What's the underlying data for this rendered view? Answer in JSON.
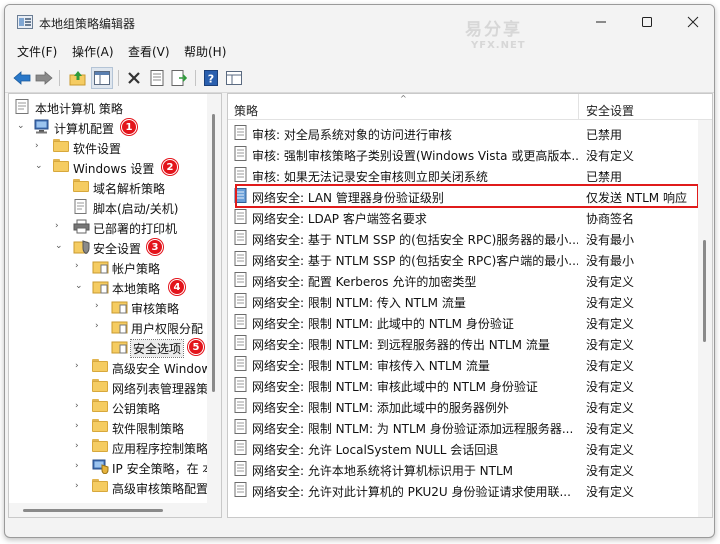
{
  "window": {
    "title": "本地组策略编辑器",
    "watermark_main": "易分享",
    "watermark_sub": "YFX.NET"
  },
  "menu": [
    {
      "label": "文件(F)"
    },
    {
      "label": "操作(A)"
    },
    {
      "label": "查看(V)"
    },
    {
      "label": "帮助(H)"
    }
  ],
  "toolbar": {
    "icons": [
      "back-arrow-icon",
      "forward-arrow-icon",
      "up-folder-icon",
      "show-hide-tree-icon",
      "delete-icon",
      "properties-icon",
      "export-list-icon",
      "help-icon",
      "extended-view-icon"
    ]
  },
  "tree": [
    {
      "label": "本地计算机 策略"
    },
    {
      "label": "计算机配置",
      "badge": "1"
    },
    {
      "label": "软件设置"
    },
    {
      "label": "Windows 设置",
      "badge": "2"
    },
    {
      "label": "域名解析策略"
    },
    {
      "label": "脚本(启动/关机)"
    },
    {
      "label": "已部署的打印机"
    },
    {
      "label": "安全设置",
      "badge": "3"
    },
    {
      "label": "帐户策略"
    },
    {
      "label": "本地策略",
      "badge": "4"
    },
    {
      "label": "审核策略"
    },
    {
      "label": "用户权限分配"
    },
    {
      "label": "安全选项",
      "badge": "5"
    },
    {
      "label": "高级安全 Windows"
    },
    {
      "label": "网络列表管理器策略"
    },
    {
      "label": "公钥策略"
    },
    {
      "label": "软件限制策略"
    },
    {
      "label": "应用程序控制策略"
    },
    {
      "label": "IP 安全策略，在 本"
    },
    {
      "label": "高级审核策略配置"
    }
  ],
  "list": {
    "col_policy": "策略",
    "col_setting": "安全设置",
    "rows": [
      {
        "name": "审核: 对全局系统对象的访问进行审核",
        "setting": "已禁用"
      },
      {
        "name": "审核: 强制审核策略子类别设置(Windows Vista 或更高版本...",
        "setting": "没有定义"
      },
      {
        "name": "审核: 如果无法记录安全审核则立即关闭系统",
        "setting": "已禁用"
      },
      {
        "name": "网络安全: LAN 管理器身份验证级别",
        "setting": "仅发送 NTLM 响应"
      },
      {
        "name": "网络安全: LDAP 客户端签名要求",
        "setting": "协商签名"
      },
      {
        "name": "网络安全: 基于 NTLM SSP 的(包括安全 RPC)服务器的最小...",
        "setting": "没有最小"
      },
      {
        "name": "网络安全: 基于 NTLM SSP 的(包括安全 RPC)客户端的最小...",
        "setting": "没有最小"
      },
      {
        "name": "网络安全: 配置 Kerberos 允许的加密类型",
        "setting": "没有定义"
      },
      {
        "name": "网络安全: 限制 NTLM: 传入 NTLM 流量",
        "setting": "没有定义"
      },
      {
        "name": "网络安全: 限制 NTLM: 此域中的 NTLM 身份验证",
        "setting": "没有定义"
      },
      {
        "name": "网络安全: 限制 NTLM: 到远程服务器的传出 NTLM 流量",
        "setting": "没有定义"
      },
      {
        "name": "网络安全: 限制 NTLM: 审核传入 NTLM 流量",
        "setting": "没有定义"
      },
      {
        "name": "网络安全: 限制 NTLM: 审核此域中的 NTLM 身份验证",
        "setting": "没有定义"
      },
      {
        "name": "网络安全: 限制 NTLM: 添加此域中的服务器例外",
        "setting": "没有定义"
      },
      {
        "name": "网络安全: 限制 NTLM: 为 NTLM 身份验证添加远程服务器...",
        "setting": "没有定义"
      },
      {
        "name": "网络安全: 允许 LocalSystem NULL 会话回退",
        "setting": "没有定义"
      },
      {
        "name": "网络安全: 允许本地系统将计算机标识用于 NTLM",
        "setting": "没有定义"
      },
      {
        "name": "网络安全: 允许对此计算机的 PKU2U 身份验证请求使用联...",
        "setting": "没有定义"
      }
    ]
  },
  "colors": {
    "highlight_border": "#e01b1b",
    "badge_red": "#e3141b",
    "folder_yellow": "#f5cc62"
  }
}
